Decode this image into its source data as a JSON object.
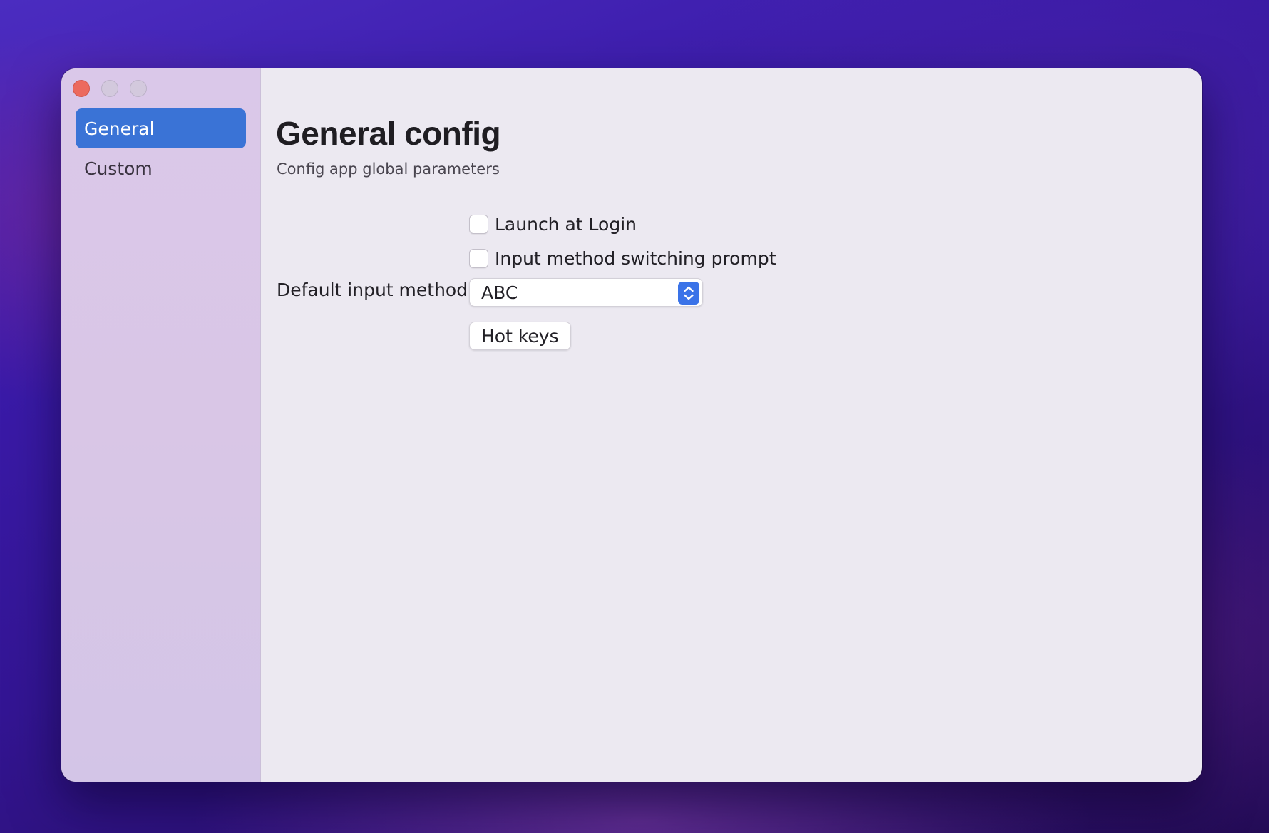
{
  "window": {
    "traffic_lights": [
      "close",
      "minimize",
      "zoom"
    ]
  },
  "sidebar": {
    "items": [
      {
        "label": "General",
        "selected": true
      },
      {
        "label": "Custom",
        "selected": false
      }
    ]
  },
  "main": {
    "title": "General config",
    "subtitle": "Config app global parameters",
    "options": [
      {
        "label": "Launch at Login",
        "checked": false
      },
      {
        "label": "Input method switching prompt",
        "checked": false
      }
    ],
    "default_input": {
      "label": "Default input method",
      "value": "ABC",
      "icon": "chevron-up-down-icon"
    },
    "hotkeys_button": "Hot keys"
  },
  "colors": {
    "accent": "#3a73d6",
    "close_light": "#ec6a5e"
  }
}
